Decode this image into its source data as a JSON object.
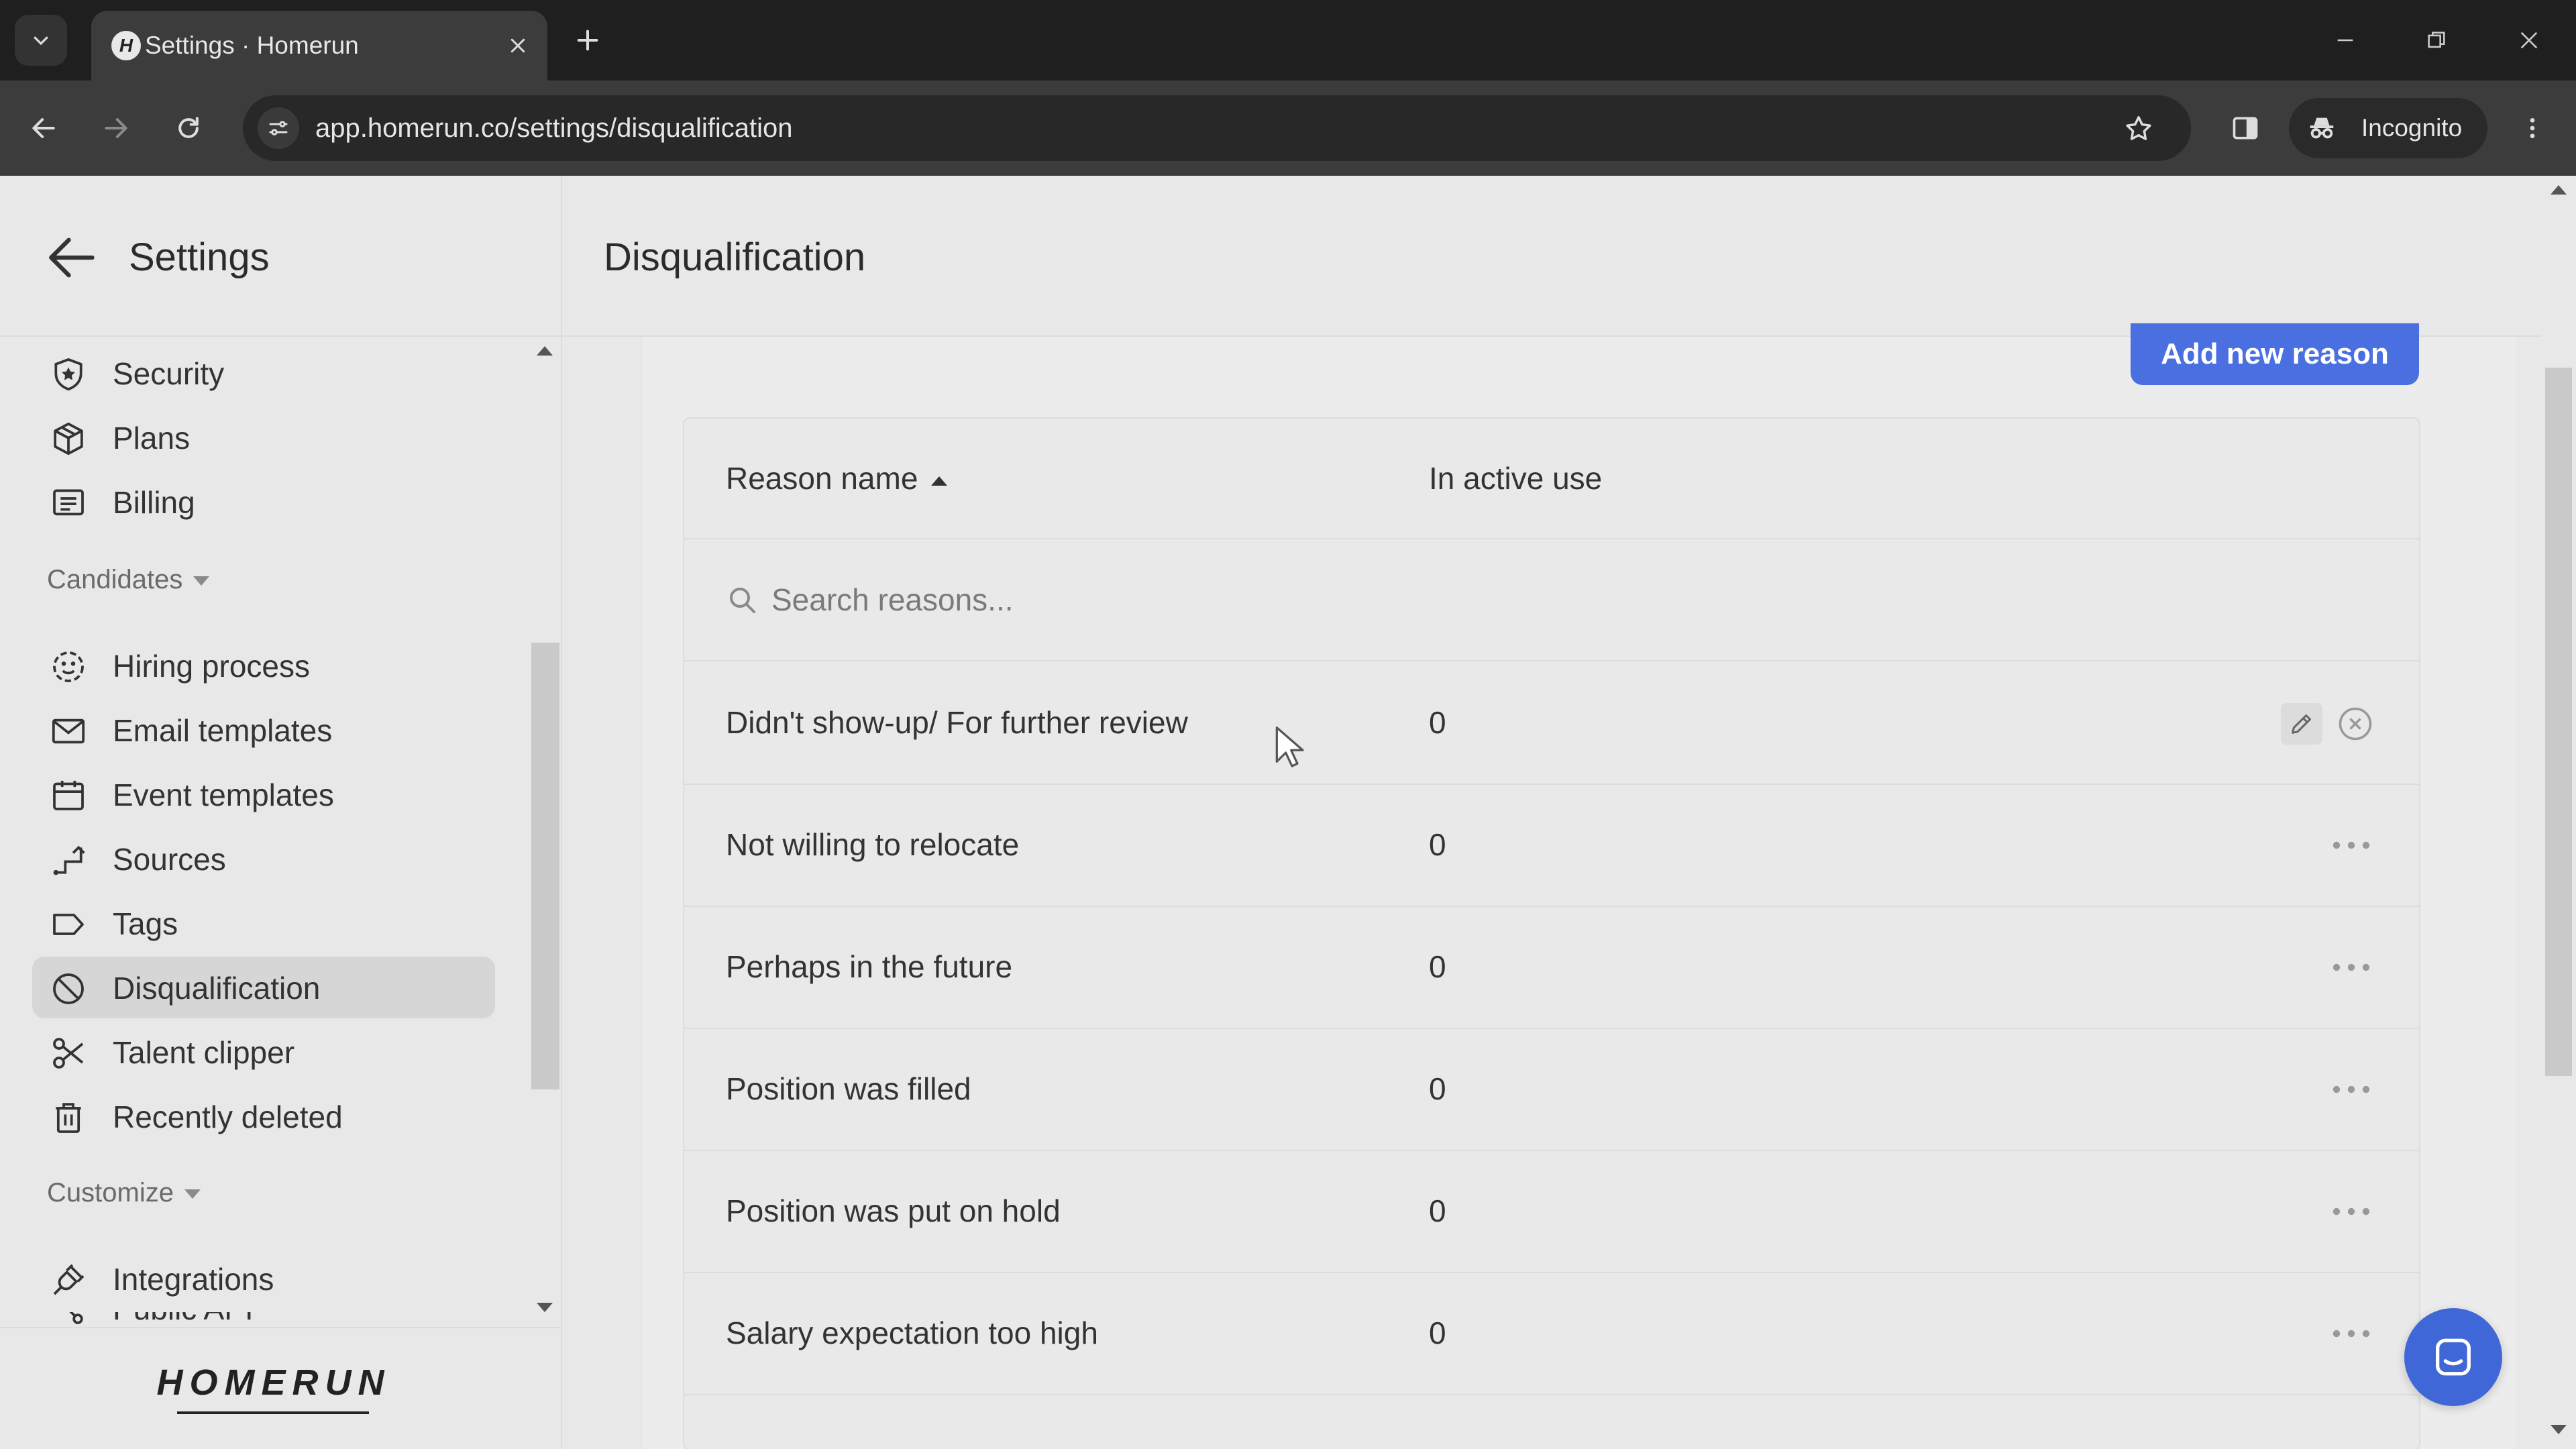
{
  "browser": {
    "tab_title": "Settings · Homerun",
    "favicon_letter": "H",
    "url": "app.homerun.co/settings/disqualification",
    "profile_label": "Incognito"
  },
  "sidebar": {
    "title": "Settings",
    "items_top": [
      {
        "label": "Security",
        "icon": "shield-star-icon"
      },
      {
        "label": "Plans",
        "icon": "box-icon"
      },
      {
        "label": "Billing",
        "icon": "receipt-icon"
      }
    ],
    "candidates_section": "Candidates",
    "candidates_items": [
      {
        "label": "Hiring process",
        "icon": "process-circle-icon"
      },
      {
        "label": "Email templates",
        "icon": "mail-icon"
      },
      {
        "label": "Event templates",
        "icon": "calendar-icon"
      },
      {
        "label": "Sources",
        "icon": "route-icon"
      },
      {
        "label": "Tags",
        "icon": "tag-icon"
      },
      {
        "label": "Disqualification",
        "icon": "ban-icon",
        "active": true
      },
      {
        "label": "Talent clipper",
        "icon": "scissors-icon"
      },
      {
        "label": "Recently deleted",
        "icon": "trash-icon"
      }
    ],
    "customize_section": "Customize",
    "customize_items": [
      {
        "label": "Integrations",
        "icon": "plug-icon"
      },
      {
        "label": "Public API",
        "icon": "api-icon"
      }
    ],
    "logo_text": "HOMERUN"
  },
  "main": {
    "page_title": "Disqualification",
    "add_button_label": "Add new reason",
    "table": {
      "col_name": "Reason name",
      "col_active": "In active use",
      "search_placeholder": "Search reasons...",
      "rows": [
        {
          "name": "Didn't show-up/ For further review",
          "count": "0"
        },
        {
          "name": "Not willing to relocate",
          "count": "0"
        },
        {
          "name": "Perhaps in the future",
          "count": "0"
        },
        {
          "name": "Position was filled",
          "count": "0"
        },
        {
          "name": "Position was put on hold",
          "count": "0"
        },
        {
          "name": "Salary expectation too high",
          "count": "0"
        }
      ]
    }
  },
  "colors": {
    "accent": "#4a6fe0",
    "chat": "#3f67d8",
    "active_nav": "#d6d6d6"
  }
}
